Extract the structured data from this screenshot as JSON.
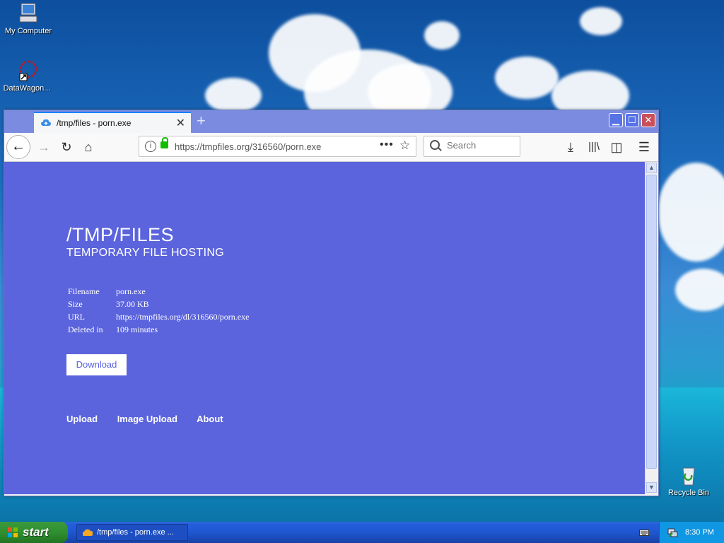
{
  "desktop": {
    "icons": [
      {
        "label": "My Computer",
        "icon": "computer-icon"
      },
      {
        "label": "DataWagon...",
        "icon": "datawagon-icon"
      },
      {
        "label": "Recycle Bin",
        "icon": "recycle-bin-icon"
      }
    ]
  },
  "browser": {
    "tab": {
      "title": "/tmp/files - porn.exe",
      "favicon": "cloud-upload-icon"
    },
    "url": "https://tmpfiles.org/316560/porn.exe",
    "search_placeholder": "Search"
  },
  "page": {
    "title": "/TMP/FILES",
    "subtitle": "TEMPORARY FILE HOSTING",
    "file_info": [
      {
        "key": "Filename",
        "value": "porn.exe"
      },
      {
        "key": "Size",
        "value": "37.00 KB"
      },
      {
        "key": "URL",
        "value": "https://tmpfiles.org/dl/316560/porn.exe"
      },
      {
        "key": "Deleted in",
        "value": "109 minutes"
      }
    ],
    "download_label": "Download",
    "footer_links": [
      "Upload",
      "Image Upload",
      "About"
    ],
    "background_color": "#5b64dd"
  },
  "taskbar": {
    "start_label": "start",
    "task_item": "/tmp/files - porn.exe ...",
    "clock": "8:30 PM"
  }
}
